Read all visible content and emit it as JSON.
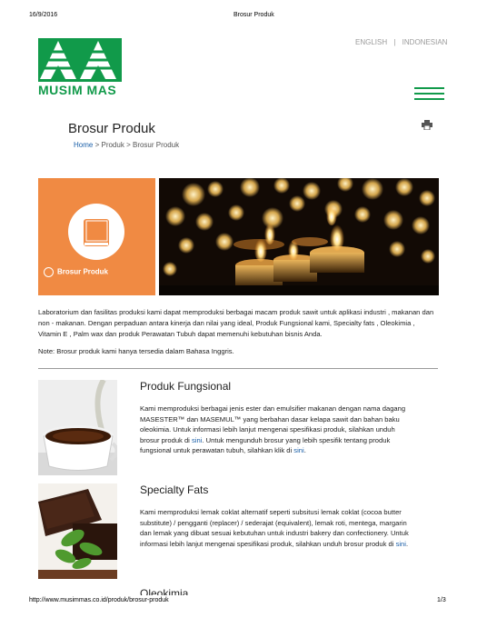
{
  "print_header": {
    "date": "16/9/2016",
    "title": "Brosur Produk"
  },
  "print_footer": {
    "url": "http://www.musimmas.co.id/produk/brosur-produk",
    "page": "1/3"
  },
  "brand": {
    "name": "MUSIM MAS",
    "color": "#119a4a"
  },
  "lang": {
    "english": "ENGLISH",
    "separator": "|",
    "indonesian": "INDONESIAN"
  },
  "page": {
    "title": "Brosur Produk"
  },
  "breadcrumb": {
    "home": "Home",
    "sep": ">",
    "produk": "Produk",
    "current": "Brosur Produk"
  },
  "banner": {
    "label": "Brosur Produk",
    "accent": "#f08a43"
  },
  "intro": "Laboratorium dan fasilitas produksi kami dapat memproduksi berbagai macam produk sawit untuk aplikasi industri , makanan dan non - makanan. Dengan perpaduan antara kinerja dan nilai yang ideal, Produk Fungsional kami, Specialty fats , Oleokimia , Vitamin E , Palm wax dan produk Perawatan Tubuh dapat memenuhi kebutuhan bisnis Anda.",
  "note": "Note: Brosur produk kami hanya tersedia dalam Bahasa Inggris.",
  "sections": [
    {
      "title": "Produk Fungsional",
      "body_a": "Kami memproduksi berbagai jenis ester dan emulsifier makanan dengan nama dagang MASESTER™ dan MASEMUL™ yang berbahan dasar kelapa sawit dan bahan baku oleokimia. Untuk informasi lebih lanjut mengenai spesifikasi produk, silahkan unduh brosur produk di",
      "link_a": "sini",
      "body_b": ". Untuk mengunduh brosur yang lebih spesifik tentang produk fungsional untuk perawatan tubuh, silahkan klik di",
      "link_b": "sini",
      "body_c": "."
    },
    {
      "title": "Specialty Fats",
      "body_a": "Kami memproduksi lemak coklat alternatif seperti subsitusi lemak coklat (cocoa butter substitute) / pengganti (replacer) / sederajat (equivalent), lemak roti, mentega, margarin dan lemak yang dibuat sesuai kebutuhan untuk industri bakery dan confectionery. Untuk informasi lebih lanjut mengenai spesifikasi produk, silahkan unduh brosur produk di",
      "link_a": "sini",
      "body_b": "."
    },
    {
      "title": "Oleokimia"
    }
  ]
}
